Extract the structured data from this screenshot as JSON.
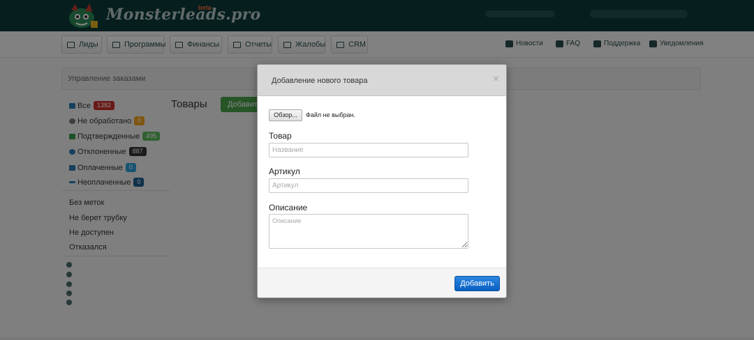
{
  "header": {
    "logo_text": "Monsterleads.pro",
    "logo_badge": "beta"
  },
  "nav": {
    "items": [
      {
        "label": "Лиды"
      },
      {
        "label": "Программы"
      },
      {
        "label": "Финансы"
      },
      {
        "label": "Отчеты"
      },
      {
        "label": "Жалобы"
      },
      {
        "label": "CRM"
      }
    ],
    "right_links": [
      {
        "label": "Новости"
      },
      {
        "label": "FAQ"
      },
      {
        "label": "Поддержка"
      },
      {
        "label": "Уведомления"
      }
    ]
  },
  "panel": {
    "title": "Управление заказами"
  },
  "sidebar": {
    "statuses": [
      {
        "label": "Все",
        "count": "1382",
        "color": "#c9302c"
      },
      {
        "label": "Не обработано",
        "count": "0",
        "color": "#f0a21c"
      },
      {
        "label": "Подтвержденные",
        "count": "495",
        "color": "#5cb85c"
      },
      {
        "label": "Отклоненные",
        "count": "887",
        "color": "#333333"
      },
      {
        "label": "Оплаченные",
        "count": "0",
        "color": "#2a9fd6"
      },
      {
        "label": "Неоплаченные",
        "count": "0",
        "color": "#1d5f8a"
      }
    ],
    "tags": [
      {
        "label": "Без меток"
      },
      {
        "label": "Не берет трубку"
      },
      {
        "label": "Не доступен"
      },
      {
        "label": "Отказался"
      }
    ]
  },
  "page": {
    "title": "Товары",
    "add_button": "Добавить"
  },
  "modal": {
    "title": "Добавление нового товара",
    "close": "×",
    "file_button": "Обзор...",
    "file_status": "Файл не выбран.",
    "product_label": "Товар",
    "product_placeholder": "Название",
    "sku_label": "Артикул",
    "sku_placeholder": "Артикул",
    "description_label": "Описание",
    "description_placeholder": "Описание",
    "submit": "Добавить"
  }
}
